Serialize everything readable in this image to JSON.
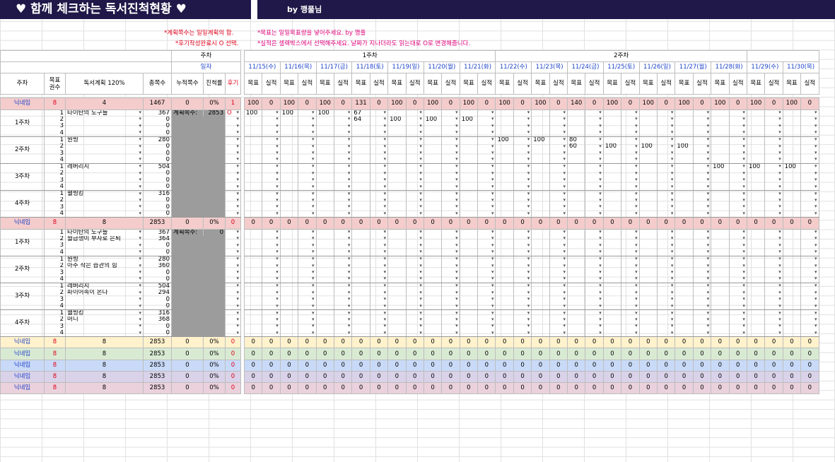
{
  "title": {
    "main": "♥ 함께 체크하는 독서진척현황 ♥",
    "byline": "by 깽풀님"
  },
  "notes": {
    "left1": "*계획쪽수는 일일계획의 합.",
    "left2": "*후기작성완료시 O 선택.",
    "right1": "*목표는 일일목표량을 넣어주세요. by 깽풀",
    "right2": "*실적은 셀렉박스에서 선택해주세요. 날짜가 지나더라도 읽는대로 O로 변경해줍니다."
  },
  "header": {
    "week_label": "주차",
    "date_label": "일자",
    "week1": "1주차",
    "week2": "2주차",
    "col_week": "주차",
    "col_goal_count": "목표\n권수",
    "col_plan": "독서계획 120%",
    "col_total": "총쪽수",
    "col_cum": "누적쪽수",
    "col_progress": "진척률",
    "col_review": "후기",
    "goal": "목표",
    "actual": "실적",
    "dates": [
      "11/15(수)",
      "11/16(목)",
      "11/17(금)",
      "11/18(토)",
      "11/19(일)",
      "11/20(월)",
      "11/21(화)",
      "11/22(수)",
      "11/23(목)",
      "11/24(금)",
      "11/25(토)",
      "11/26(일)",
      "11/27(월)",
      "11/28(화)",
      "11/29(수)",
      "11/30(목)"
    ]
  },
  "sections": [
    {
      "nick": "닉네임",
      "goal_count": "8",
      "plan_count": "4",
      "total": "1467",
      "cum": "0",
      "progress": "0%",
      "review": "1",
      "bg": "#f4cccc",
      "daily": [
        "100",
        "0",
        "100",
        "0",
        "100",
        "0",
        "131",
        "0",
        "100",
        "0",
        "100",
        "0",
        "100",
        "0",
        "100",
        "0",
        "100",
        "0",
        "140",
        "0",
        "100",
        "0",
        "100",
        "0",
        "100",
        "0",
        "100",
        "0",
        "100",
        "0",
        "100",
        "0"
      ],
      "plan_label": "계획쪽수:",
      "plan_value": "2853",
      "review_mark": "O",
      "weeks": [
        {
          "label": "1주차",
          "rows": [
            {
              "n": "1",
              "book": "타이탄의 도구들",
              "pages": "367",
              "cells": {
                "0": "100",
                "2": "100",
                "4": "100",
                "6": "67"
              }
            },
            {
              "n": "2",
              "book": "",
              "pages": "0",
              "cells": {
                "6": "64",
                "8": "100",
                "10": "100",
                "12": "100"
              }
            },
            {
              "n": "3",
              "book": "",
              "pages": "0",
              "cells": {}
            },
            {
              "n": "4",
              "book": "",
              "pages": "0",
              "cells": {}
            }
          ]
        },
        {
          "label": "2주차",
          "rows": [
            {
              "n": "1",
              "book": "원씽",
              "pages": "280",
              "cells": {
                "14": "100",
                "16": "100",
                "18": "80"
              }
            },
            {
              "n": "2",
              "book": "",
              "pages": "0",
              "cells": {
                "18": "60",
                "20": "100",
                "22": "100",
                "24": "100"
              }
            },
            {
              "n": "3",
              "book": "",
              "pages": "0",
              "cells": {}
            },
            {
              "n": "4",
              "book": "",
              "pages": "0",
              "cells": {}
            }
          ]
        },
        {
          "label": "3주차",
          "rows": [
            {
              "n": "1",
              "book": "레버리지",
              "pages": "504",
              "cells": {
                "26": "100",
                "28": "100",
                "30": "100"
              }
            },
            {
              "n": "2",
              "book": "",
              "pages": "0",
              "cells": {}
            },
            {
              "n": "3",
              "book": "",
              "pages": "0",
              "cells": {}
            },
            {
              "n": "4",
              "book": "",
              "pages": "0",
              "cells": {}
            }
          ]
        },
        {
          "label": "4주차",
          "rows": [
            {
              "n": "1",
              "book": "웰씽킹",
              "pages": "316",
              "cells": {}
            },
            {
              "n": "2",
              "book": "",
              "pages": "0",
              "cells": {}
            },
            {
              "n": "3",
              "book": "",
              "pages": "0",
              "cells": {}
            },
            {
              "n": "4",
              "book": "",
              "pages": "0",
              "cells": {}
            }
          ]
        }
      ]
    },
    {
      "nick": "닉네임",
      "goal_count": "8",
      "plan_count": "8",
      "total": "2853",
      "cum": "0",
      "progress": "0%",
      "review": "0",
      "bg": "#f4cccc",
      "daily": [
        "0",
        "0",
        "0",
        "0",
        "0",
        "0",
        "0",
        "0",
        "0",
        "0",
        "0",
        "0",
        "0",
        "0",
        "0",
        "0",
        "0",
        "0",
        "0",
        "0",
        "0",
        "0",
        "0",
        "0",
        "0",
        "0",
        "0",
        "0",
        "0",
        "0",
        "0",
        "0"
      ],
      "plan_label": "계획쪽수:",
      "plan_value": "0",
      "review_mark": "",
      "weeks": [
        {
          "label": "1주차",
          "rows": [
            {
              "n": "1",
              "book": "타이탄의 도구들",
              "pages": "367",
              "cells": {}
            },
            {
              "n": "2",
              "book": "월급쟁이 부자로 은퇴",
              "pages": "364",
              "cells": {}
            },
            {
              "n": "3",
              "book": "",
              "pages": "0",
              "cells": {}
            },
            {
              "n": "4",
              "book": "",
              "pages": "0",
              "cells": {}
            }
          ]
        },
        {
          "label": "2주차",
          "rows": [
            {
              "n": "1",
              "book": "원씽",
              "pages": "280",
              "cells": {}
            },
            {
              "n": "2",
              "book": "아주 작은 습관의 힘",
              "pages": "360",
              "cells": {}
            },
            {
              "n": "3",
              "book": "",
              "pages": "0",
              "cells": {}
            },
            {
              "n": "4",
              "book": "",
              "pages": "0",
              "cells": {}
            }
          ]
        },
        {
          "label": "3주차",
          "rows": [
            {
              "n": "1",
              "book": "레버리지",
              "pages": "504",
              "cells": {}
            },
            {
              "n": "2",
              "book": "파이어족이 온다",
              "pages": "294",
              "cells": {}
            },
            {
              "n": "3",
              "book": "",
              "pages": "0",
              "cells": {}
            },
            {
              "n": "4",
              "book": "",
              "pages": "0",
              "cells": {}
            }
          ]
        },
        {
          "label": "4주차",
          "rows": [
            {
              "n": "1",
              "book": "웰씽킹",
              "pages": "316",
              "cells": {}
            },
            {
              "n": "2",
              "book": "머니",
              "pages": "368",
              "cells": {}
            },
            {
              "n": "3",
              "book": "",
              "pages": "0",
              "cells": {}
            },
            {
              "n": "4",
              "book": "",
              "pages": "0",
              "cells": {}
            }
          ]
        }
      ]
    }
  ],
  "summary_rows": [
    {
      "nick": "닉네임",
      "goal_count": "8",
      "plan_count": "8",
      "total": "2853",
      "cum": "0",
      "progress": "0%",
      "review": "0",
      "bg": "#fff2cc"
    },
    {
      "nick": "닉네임",
      "goal_count": "8",
      "plan_count": "8",
      "total": "2853",
      "cum": "0",
      "progress": "0%",
      "review": "0",
      "bg": "#d9ead3"
    },
    {
      "nick": "닉네임",
      "goal_count": "8",
      "plan_count": "8",
      "total": "2853",
      "cum": "0",
      "progress": "0%",
      "review": "0",
      "bg": "#c9daf8"
    },
    {
      "nick": "닉네임",
      "goal_count": "8",
      "plan_count": "8",
      "total": "2853",
      "cum": "0",
      "progress": "0%",
      "review": "0",
      "bg": "#d9d2e9"
    },
    {
      "nick": "닉네임",
      "goal_count": "8",
      "plan_count": "8",
      "total": "2853",
      "cum": "0",
      "progress": "0%",
      "review": "0",
      "bg": "#ead1dc"
    }
  ],
  "summary_daily": "0"
}
